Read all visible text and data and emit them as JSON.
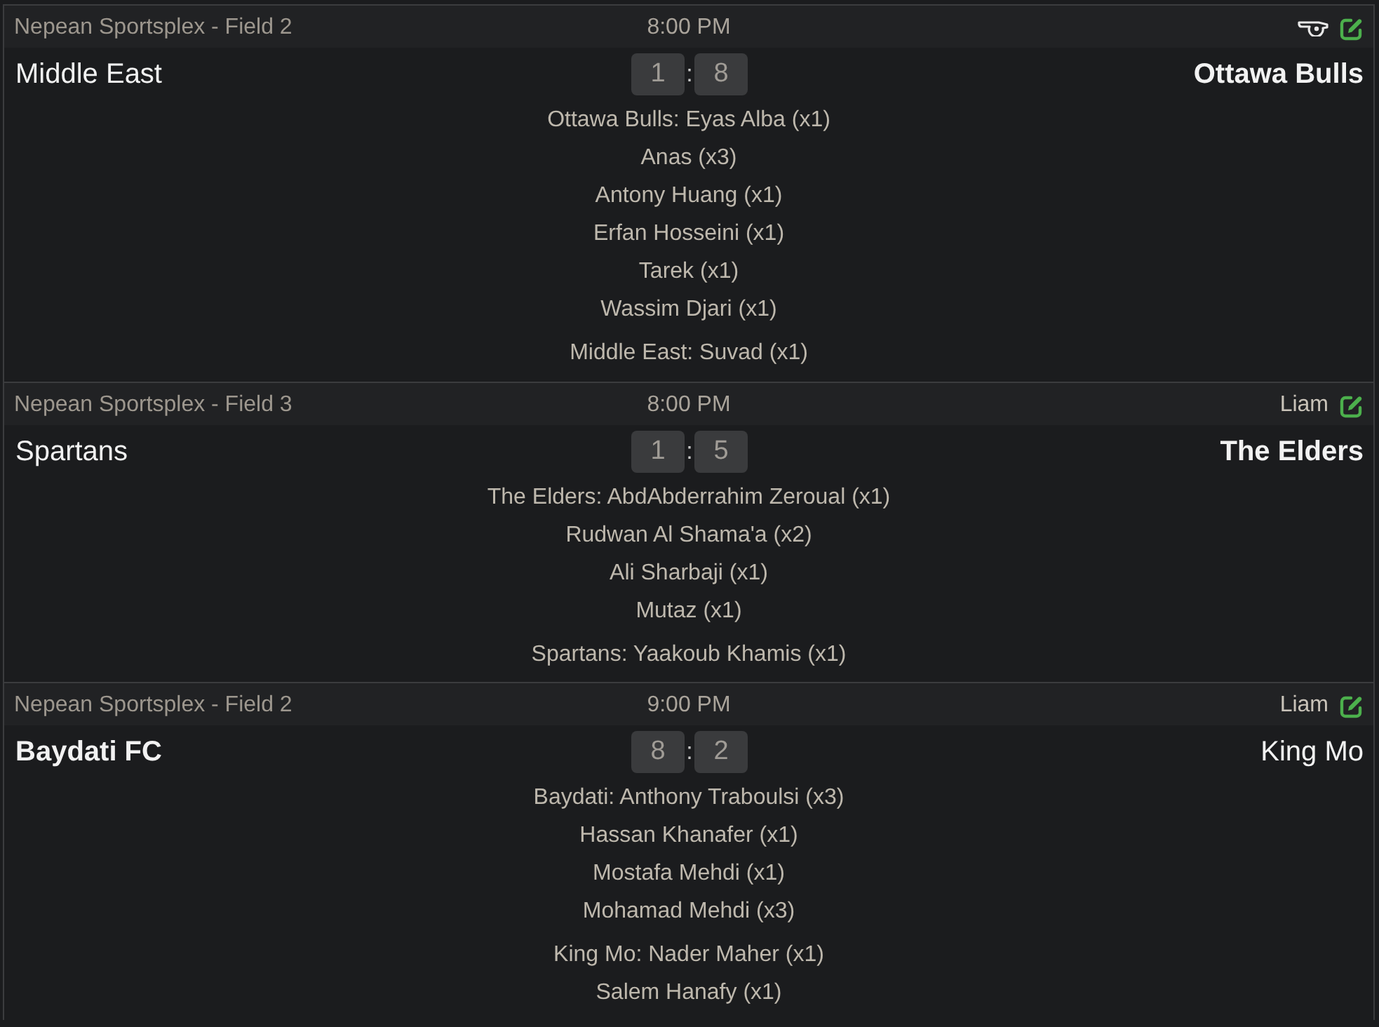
{
  "games": [
    {
      "venue": "Nepean Sportsplex - Field 2",
      "time": "8:00 PM",
      "referee": {
        "kind": "icon"
      },
      "home": {
        "name": "Middle East",
        "winner": false
      },
      "score": {
        "home": "1",
        "separator": ":",
        "away": "8"
      },
      "away": {
        "name": "Ottawa Bulls",
        "winner": true
      },
      "scorer_groups": [
        {
          "lines": [
            "Ottawa Bulls: Eyas Alba (x1)",
            "Anas (x3)",
            "Antony Huang (x1)",
            "Erfan Hosseini (x1)",
            "Tarek (x1)",
            "Wassim Djari (x1)"
          ]
        },
        {
          "lines": [
            "Middle East: Suvad (x1)"
          ]
        }
      ]
    },
    {
      "venue": "Nepean Sportsplex - Field 3",
      "time": "8:00 PM",
      "referee": {
        "kind": "name",
        "name": "Liam"
      },
      "home": {
        "name": "Spartans",
        "winner": false
      },
      "score": {
        "home": "1",
        "separator": ":",
        "away": "5"
      },
      "away": {
        "name": "The Elders",
        "winner": true
      },
      "scorer_groups": [
        {
          "lines": [
            "The Elders: AbdAbderrahim Zeroual (x1)",
            "Rudwan Al Shama'a (x2)",
            "Ali Sharbaji (x1)",
            "Mutaz (x1)"
          ]
        },
        {
          "lines": [
            "Spartans: Yaakoub Khamis (x1)"
          ]
        }
      ]
    },
    {
      "venue": "Nepean Sportsplex - Field 2",
      "time": "9:00 PM",
      "referee": {
        "kind": "name",
        "name": "Liam"
      },
      "home": {
        "name": "Baydati FC",
        "winner": true
      },
      "score": {
        "home": "8",
        "separator": ":",
        "away": "2"
      },
      "away": {
        "name": "King Mo",
        "winner": false
      },
      "scorer_groups": [
        {
          "lines": [
            "Baydati: Anthony Traboulsi (x3)",
            "Hassan Khanafer (x1)",
            "Mostafa Mehdi (x1)",
            "Mohamad Mehdi (x3)"
          ]
        },
        {
          "lines": [
            "King Mo: Nader Maher (x1)",
            "Salem Hanafy (x1)"
          ]
        }
      ]
    }
  ]
}
